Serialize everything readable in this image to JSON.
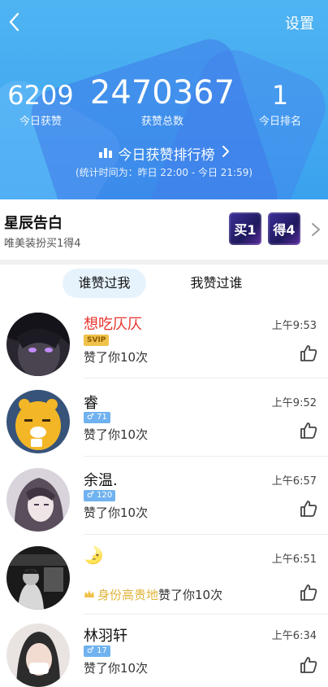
{
  "header": {
    "settings_label": "设置",
    "today_likes": {
      "value": "6209",
      "label": "今日获赞"
    },
    "total_likes": {
      "value": "2470367",
      "label": "获赞总数"
    },
    "today_rank": {
      "value": "1",
      "label": "今日排名"
    },
    "rank_link_label": "今日获赞排行榜",
    "stat_note": "(统计时间为：昨日 22:00 - 今日 21:59)"
  },
  "promo": {
    "title": "星辰告白",
    "subtitle": "唯美装扮买1得4",
    "badge1": "买1",
    "badge2": "得4"
  },
  "tabs": [
    {
      "label": "谁赞过我",
      "active": true
    },
    {
      "label": "我赞过谁",
      "active": false
    }
  ],
  "list": [
    {
      "name": "想吃仄仄",
      "name_color": "#e8312c",
      "badge": "SVIP",
      "time": "上午9:53",
      "message": "赞了你10次"
    },
    {
      "name": "睿",
      "badge": "♂ 71",
      "time": "上午9:52",
      "message": "赞了你10次"
    },
    {
      "name": "余温.",
      "badge": "♂ 120",
      "time": "上午6:57",
      "message": "赞了你10次"
    },
    {
      "name": "🌛",
      "time": "上午6:51",
      "prefix": "身份高贵地",
      "message": "赞了你10次"
    },
    {
      "name": "林羽轩",
      "badge": "♂ 17",
      "time": "上午6:34",
      "message": "赞了你10次"
    }
  ],
  "colors": {
    "header_blue": "#3aa2ee",
    "svip_gold": "#f0c24a",
    "gender_badge_blue": "#6fb2ef",
    "noble_text": "#e0b43a"
  }
}
